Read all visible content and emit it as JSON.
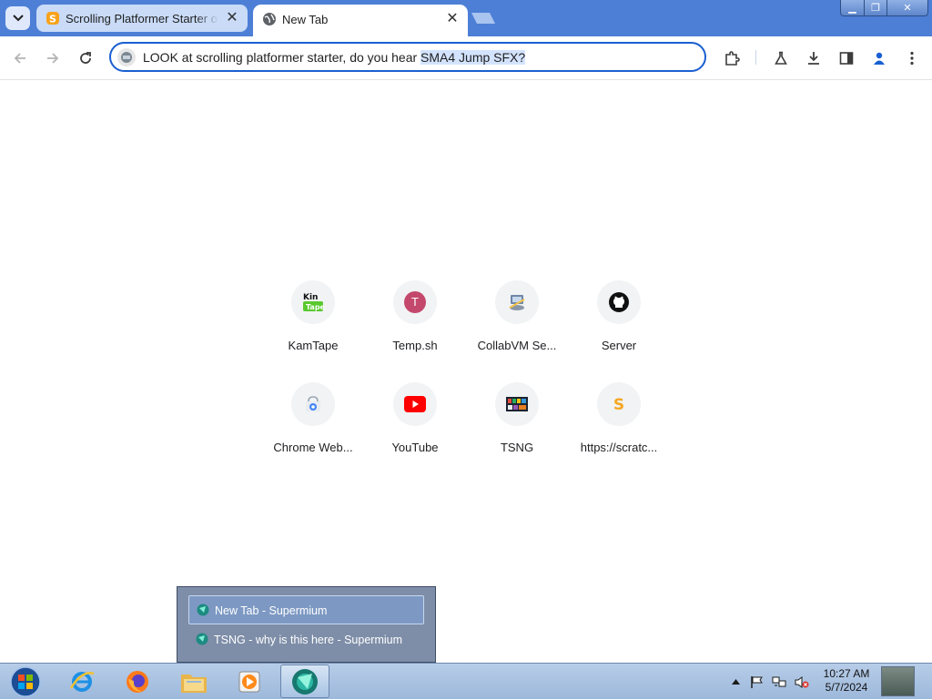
{
  "browser": {
    "tabs": [
      {
        "title": "Scrolling Platformer Starter on Scratch",
        "close": "✕",
        "active": false,
        "favicon": "scratch-icon"
      },
      {
        "title": "New Tab",
        "close": "✕",
        "active": true,
        "favicon": "globe-icon"
      }
    ],
    "window_controls": {
      "minimize": "▁",
      "maximize": "❐",
      "close": "✕"
    }
  },
  "toolbar": {
    "omnibox_text": "LOOK at scrolling platformer starter, do you hear ",
    "omnibox_selected": "SMA4 Jump SFX?"
  },
  "shortcuts": [
    {
      "label": "KamTape",
      "icon": "kamtape-icon"
    },
    {
      "label": "Temp.sh",
      "icon": "letter-t-icon",
      "letter": "T"
    },
    {
      "label": "CollabVM Se...",
      "icon": "collabvm-icon"
    },
    {
      "label": "Server",
      "icon": "github-icon"
    },
    {
      "label": "Chrome Web...",
      "icon": "chrome-web-store-icon"
    },
    {
      "label": "YouTube",
      "icon": "youtube-icon"
    },
    {
      "label": "TSNG",
      "icon": "tsng-icon"
    },
    {
      "label": "https://scratc...",
      "icon": "scratch-icon"
    }
  ],
  "taskbar_popup": {
    "items": [
      {
        "label": "New Tab - Supermium",
        "selected": true
      },
      {
        "label": "TSNG - why is this here - Supermium",
        "selected": false
      }
    ]
  },
  "taskbar": {
    "clock_time": "10:27 AM",
    "clock_date": "5/7/2024",
    "apps": [
      "start-orb-icon",
      "internet-explorer-icon",
      "firefox-icon",
      "file-explorer-icon",
      "media-player-icon",
      "supermium-icon"
    ]
  },
  "colors": {
    "titlebar": "#4d7fd6",
    "omnibox_border": "#1a5fd1",
    "selection": "#d3e3fd",
    "youtube_red": "#ff0000",
    "temp_sh": "#c4486c"
  }
}
